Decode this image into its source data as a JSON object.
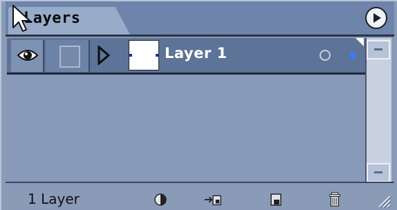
{
  "panel": {
    "tab_title": "Layers",
    "menu_button_icon": "play-circle-icon"
  },
  "layers": [
    {
      "name": "Layer 1",
      "visible": true,
      "selected": true
    }
  ],
  "footer": {
    "count_text": "1 Layer",
    "buttons": [
      "layer-mask-icon",
      "new-fill-adjustment-icon",
      "new-layer-icon",
      "trash-icon"
    ]
  },
  "colors": {
    "panel_bg": "#8a9bb8",
    "row_selected_bg": "#5d7397",
    "accent_blue": "#3a7bff"
  }
}
